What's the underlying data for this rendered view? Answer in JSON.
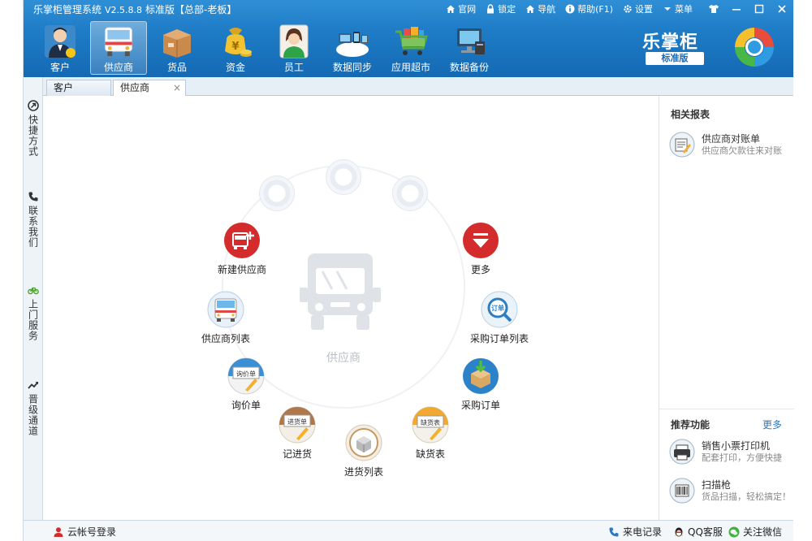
{
  "window": {
    "app_name": "乐掌柜管理系统",
    "version": "V2.5.8.8",
    "edition": "标准版",
    "account": "【总部-老板】",
    "links": [
      "官网",
      "锁定",
      "导航",
      "帮助(F1)",
      "设置",
      "菜单"
    ]
  },
  "toolbar": {
    "items": [
      "客户",
      "供应商",
      "货品",
      "资金",
      "员工",
      "数据同步",
      "应用超市",
      "数据备份"
    ],
    "active": "供应商"
  },
  "brand": {
    "name": "乐掌柜",
    "badge": "标准版"
  },
  "rail": {
    "items": [
      "快捷方式",
      "联系我们",
      "上门服务",
      "晋级通道"
    ]
  },
  "tabs": [
    {
      "label": "客户",
      "active": false
    },
    {
      "label": "供应商",
      "active": true,
      "close": "×"
    }
  ],
  "hub": {
    "center_label": "供应商",
    "nodes": {
      "new_supplier": "新建供应商",
      "more": "更多",
      "supplier_list": "供应商列表",
      "purchase_order_list": "采购订单列表",
      "inquiry": "询价单",
      "purchase_order": "采购订单",
      "record_purchase": "记进货",
      "shortage": "缺货表",
      "purchase_list": "进货列表"
    }
  },
  "side": {
    "reports_title": "相关报表",
    "report": {
      "title": "供应商对账单",
      "subtitle": "供应商欠款往来对账"
    },
    "recommend_title": "推荐功能",
    "more_link": "更多",
    "recommend": [
      {
        "title": "销售小票打印机",
        "subtitle": "配套打印，方便快捷"
      },
      {
        "title": "扫描枪",
        "subtitle": "货品扫描，轻松搞定！"
      }
    ]
  },
  "statusbar": {
    "cloud_login": "云帐号登录",
    "call_log": "来电记录",
    "qq": "QQ客服",
    "wechat": "关注微信"
  },
  "colors": {
    "title_blue": "#1e7cc6",
    "accent_red": "#d62a2a",
    "accent_blue": "#2b78c5"
  }
}
